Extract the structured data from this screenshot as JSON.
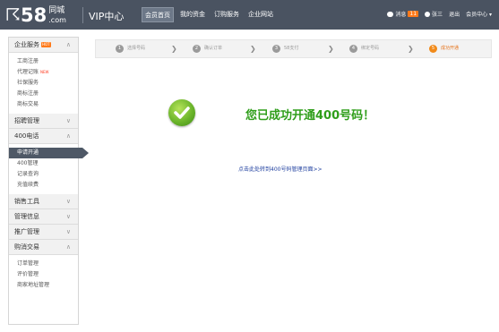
{
  "header": {
    "logo_mark": "☈",
    "logo_num": "58",
    "logo_cn_top": "同城",
    "logo_cn_bottom": ".com",
    "app_title": "VIP中心",
    "nav": [
      {
        "label": "会员首页",
        "active": true
      },
      {
        "label": "我的资金",
        "active": false
      },
      {
        "label": "订购服务",
        "active": false
      },
      {
        "label": "企业网站",
        "active": false
      }
    ],
    "messages_label": "消息",
    "messages_count": "11",
    "username": "张三",
    "logout_label": "退出",
    "user_center_label": "会员中心 ▾"
  },
  "sidebar": {
    "enterprise_services": {
      "label": "企业服务",
      "hot": "HOT",
      "chevron": "∧"
    },
    "enterprise_items": [
      {
        "label": "工商注册",
        "new": ""
      },
      {
        "label": "代理记账",
        "new": "NEW"
      },
      {
        "label": "社保服务",
        "new": ""
      },
      {
        "label": "商标注册",
        "new": ""
      },
      {
        "label": "商标交易",
        "new": ""
      }
    ],
    "recruit_mgmt": {
      "label": "招聘管理",
      "chevron": "∨"
    },
    "phone_400": {
      "label": "400电话",
      "chevron": "∧"
    },
    "phone_items": [
      {
        "label": "申请开通",
        "active": true
      },
      {
        "label": "400管理",
        "active": false
      },
      {
        "label": "记录查询",
        "active": false
      },
      {
        "label": "充值续费",
        "active": false
      }
    ],
    "sales_tools": {
      "label": "销售工具",
      "chevron": "∨"
    },
    "info_mgmt": {
      "label": "管理信息",
      "chevron": "∨"
    },
    "promo_mgmt": {
      "label": "推广管理",
      "chevron": "∨"
    },
    "trade": {
      "label": "购消交易",
      "chevron": "∧"
    },
    "trade_items": [
      {
        "label": "订单管理"
      },
      {
        "label": "评价管理"
      },
      {
        "label": "商家地址管理"
      }
    ]
  },
  "steps": [
    {
      "num": "1",
      "label": "选择号码",
      "current": false
    },
    {
      "num": "2",
      "label": "确认订单",
      "current": false
    },
    {
      "num": "3",
      "label": "58支付",
      "current": false
    },
    {
      "num": "4",
      "label": "绑定号码",
      "current": false
    },
    {
      "num": "5",
      "label": "成功开通",
      "current": true
    }
  ],
  "step_arrow": "❯",
  "main": {
    "success_message": "您已成功开通400号码！",
    "manage_link": "点击此处转到400号码管理页面>>"
  },
  "colors": {
    "topbar": "#4a5361",
    "success_green": "#2f9e1a",
    "current_step": "#f18a1a",
    "link": "#1f3f9f"
  }
}
